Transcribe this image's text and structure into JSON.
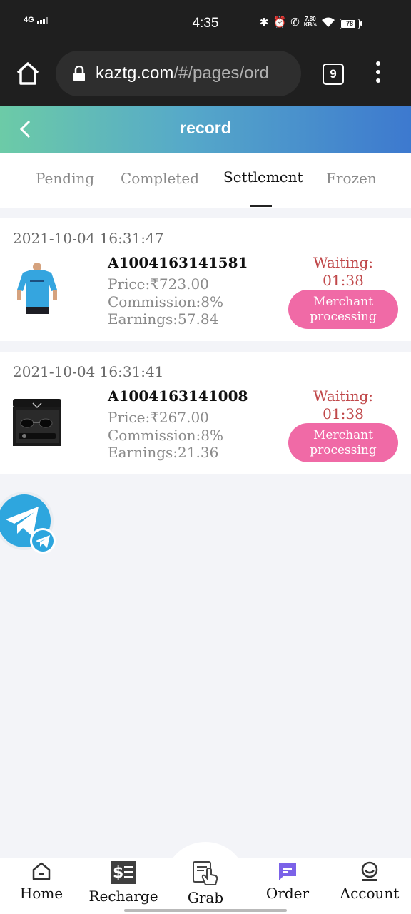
{
  "status_bar": {
    "network": "4G",
    "time": "4:35",
    "speed_value": "7.80",
    "speed_unit": "KB/s",
    "battery": "78",
    "icons": [
      "bluetooth-icon",
      "alarm-icon",
      "wifi-call-icon",
      "wifi-icon",
      "battery-icon"
    ]
  },
  "browser": {
    "url_host": "kaztg.com",
    "url_path": "/#/pages/ord",
    "tab_count": "9",
    "icons": [
      "home-icon",
      "lock-icon",
      "tabs-icon",
      "overflow-menu-icon"
    ]
  },
  "header": {
    "title": "record",
    "back_icon": "chevron-left-icon"
  },
  "tabs": [
    {
      "label": "Pending"
    },
    {
      "label": "Completed"
    },
    {
      "label": "Settlement"
    },
    {
      "label": "Frozen"
    }
  ],
  "active_tab": "Settlement",
  "orders": [
    {
      "date": "2021-10-04 16:31:47",
      "id": "A1004163141581",
      "price": "Price:₹723.00",
      "commission": "Commission:8%",
      "earnings": "Earnings:57.84",
      "waiting_label": "Waiting:",
      "waiting_time": "01:38",
      "status_line1": "Merchant",
      "status_line2": "processing",
      "image": "blue-tshirt-product-image"
    },
    {
      "date": "2021-10-04 16:31:41",
      "id": "A1004163141008",
      "price": "Price:₹267.00",
      "commission": "Commission:8%",
      "earnings": "Earnings:21.36",
      "waiting_label": "Waiting:",
      "waiting_time": "01:38",
      "status_line1": "Merchant",
      "status_line2": "processing",
      "image": "sunglasses-box-product-image"
    }
  ],
  "floating": {
    "icon": "telegram-icon"
  },
  "bottom_nav": [
    {
      "label": "Home",
      "icon": "home-icon"
    },
    {
      "label": "Recharge",
      "icon": "recharge-icon"
    },
    {
      "label": "Grab",
      "icon": "grab-hand-icon"
    },
    {
      "label": "Order",
      "icon": "order-icon"
    },
    {
      "label": "Account",
      "icon": "account-icon"
    }
  ],
  "colors": {
    "header_gradient_start": "#6ccba7",
    "header_gradient_end": "#3d79cf",
    "status_pill": "#f06aa6",
    "waiting_text": "#c0484a",
    "order_nav_icon": "#7b62e8"
  }
}
